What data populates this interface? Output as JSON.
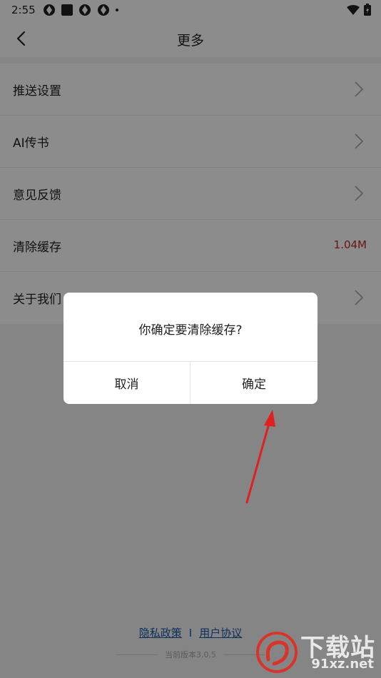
{
  "status_bar": {
    "time": "2:55"
  },
  "header": {
    "title": "更多"
  },
  "menu": {
    "items": [
      {
        "label": "推送设置"
      },
      {
        "label": "AI传书"
      },
      {
        "label": "意见反馈"
      },
      {
        "label": "清除缓存",
        "value": "1.04M"
      },
      {
        "label": "关于我们"
      }
    ]
  },
  "footer": {
    "privacy_link": "隐私政策",
    "separator": "I",
    "agreement_link": "用户协议",
    "version": "当前版本3.0.5"
  },
  "dialog": {
    "message": "你确定要清除缓存?",
    "cancel_label": "取消",
    "confirm_label": "确定"
  },
  "watermark": {
    "title": "下载站",
    "domain": "91xz.net"
  },
  "colors": {
    "accent": "#c0292b",
    "link": "#1a56a8",
    "arrow": "#e0201f"
  }
}
